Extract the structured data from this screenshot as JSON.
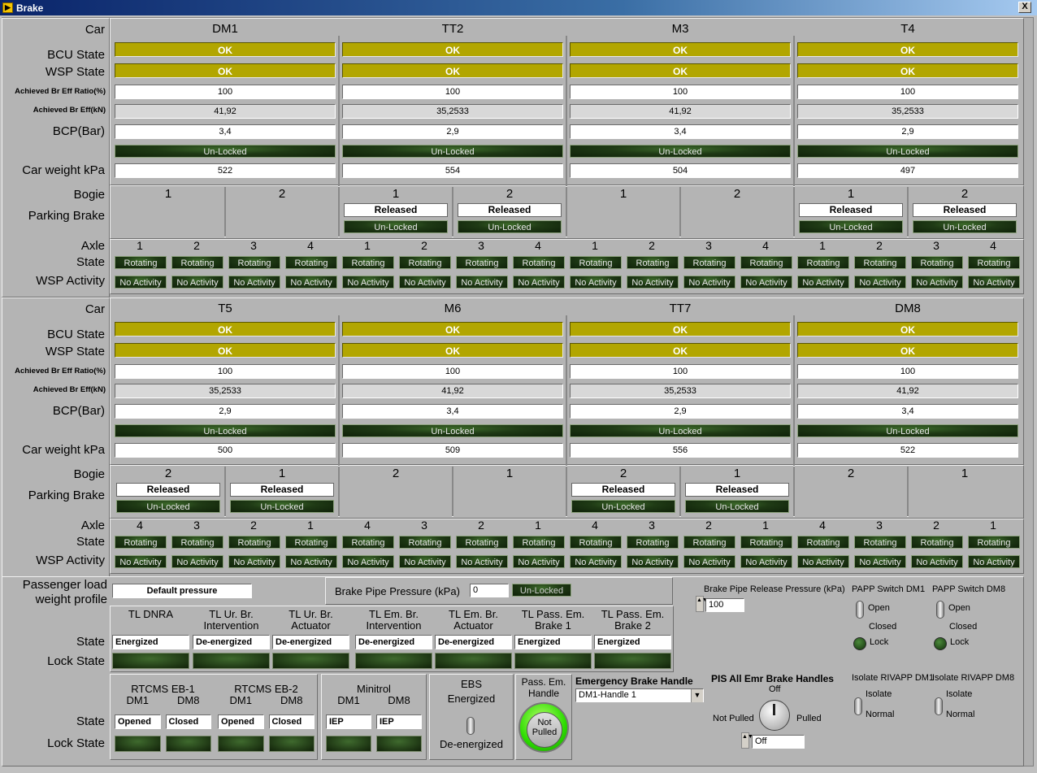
{
  "window": {
    "title": "Brake",
    "close": "X"
  },
  "labels": {
    "car": "Car",
    "bcu": "BCU State",
    "wsp": "WSP State",
    "ratio": "Achieved Br Eff Ratio(%)",
    "eff": "Achieved Br Eff(kN)",
    "bcp": "BCP(Bar)",
    "weight": "Car weight kPa",
    "bogie": "Bogie",
    "parking": "Parking Brake",
    "axle": "Axle",
    "state": "State",
    "wspact": "WSP Activity"
  },
  "upper": {
    "cars": [
      {
        "name": "DM1",
        "bcu": "OK",
        "wsp": "OK",
        "ratio": "100",
        "eff": "41,92",
        "bcp": "3,4",
        "lock": "Un-Locked",
        "weight": "522",
        "bogies": [
          {
            "n": "1",
            "released": "",
            "lock": ""
          },
          {
            "n": "2",
            "released": "",
            "lock": ""
          }
        ],
        "axles": [
          "1",
          "2",
          "3",
          "4"
        ]
      },
      {
        "name": "TT2",
        "bcu": "OK",
        "wsp": "OK",
        "ratio": "100",
        "eff": "35,2533",
        "bcp": "2,9",
        "lock": "Un-Locked",
        "weight": "554",
        "bogies": [
          {
            "n": "1",
            "released": "Released",
            "lock": "Un-Locked"
          },
          {
            "n": "2",
            "released": "Released",
            "lock": "Un-Locked"
          }
        ],
        "axles": [
          "1",
          "2",
          "3",
          "4"
        ]
      },
      {
        "name": "M3",
        "bcu": "OK",
        "wsp": "OK",
        "ratio": "100",
        "eff": "41,92",
        "bcp": "3,4",
        "lock": "Un-Locked",
        "weight": "504",
        "bogies": [
          {
            "n": "1",
            "released": "",
            "lock": ""
          },
          {
            "n": "2",
            "released": "",
            "lock": ""
          }
        ],
        "axles": [
          "1",
          "2",
          "3",
          "4"
        ]
      },
      {
        "name": "T4",
        "bcu": "OK",
        "wsp": "OK",
        "ratio": "100",
        "eff": "35,2533",
        "bcp": "2,9",
        "lock": "Un-Locked",
        "weight": "497",
        "bogies": [
          {
            "n": "1",
            "released": "Released",
            "lock": "Un-Locked"
          },
          {
            "n": "2",
            "released": "Released",
            "lock": "Un-Locked"
          }
        ],
        "axles": [
          "1",
          "2",
          "3",
          "4"
        ]
      }
    ]
  },
  "lower": {
    "cars": [
      {
        "name": "T5",
        "bcu": "OK",
        "wsp": "OK",
        "ratio": "100",
        "eff": "35,2533",
        "bcp": "2,9",
        "lock": "Un-Locked",
        "weight": "500",
        "bogies": [
          {
            "n": "2",
            "released": "Released",
            "lock": "Un-Locked"
          },
          {
            "n": "1",
            "released": "Released",
            "lock": "Un-Locked"
          }
        ],
        "axles": [
          "4",
          "3",
          "2",
          "1"
        ]
      },
      {
        "name": "M6",
        "bcu": "OK",
        "wsp": "OK",
        "ratio": "100",
        "eff": "41,92",
        "bcp": "3,4",
        "lock": "Un-Locked",
        "weight": "509",
        "bogies": [
          {
            "n": "2",
            "released": "",
            "lock": ""
          },
          {
            "n": "1",
            "released": "",
            "lock": ""
          }
        ],
        "axles": [
          "4",
          "3",
          "2",
          "1"
        ]
      },
      {
        "name": "TT7",
        "bcu": "OK",
        "wsp": "OK",
        "ratio": "100",
        "eff": "35,2533",
        "bcp": "2,9",
        "lock": "Un-Locked",
        "weight": "556",
        "bogies": [
          {
            "n": "2",
            "released": "Released",
            "lock": "Un-Locked"
          },
          {
            "n": "1",
            "released": "Released",
            "lock": "Un-Locked"
          }
        ],
        "axles": [
          "4",
          "3",
          "2",
          "1"
        ]
      },
      {
        "name": "DM8",
        "bcu": "OK",
        "wsp": "OK",
        "ratio": "100",
        "eff": "41,92",
        "bcp": "3,4",
        "lock": "Un-Locked",
        "weight": "522",
        "bogies": [
          {
            "n": "2",
            "released": "",
            "lock": ""
          },
          {
            "n": "1",
            "released": "",
            "lock": ""
          }
        ],
        "axles": [
          "4",
          "3",
          "2",
          "1"
        ]
      }
    ]
  },
  "axle_state": "Rotating",
  "wsp_activity": "No Activity",
  "bottom": {
    "pass_load_label": "Passenger load weight profile",
    "pass_load_value": "Default pressure",
    "bpp_label": "Brake Pipe Pressure (kPa)",
    "bpp_value": "0",
    "bpp_lock": "Un-Locked",
    "state_label": "State",
    "lock_state_label": "Lock State",
    "tl": [
      {
        "name": "TL DNRA",
        "state": "Energized"
      },
      {
        "name": "TL Ur. Br. Intervention",
        "state": "De-energized"
      },
      {
        "name": "TL Ur. Br. Actuator",
        "state": "De-energized"
      },
      {
        "name": "TL Em. Br. Intervention",
        "state": "De-energized"
      },
      {
        "name": "TL Em. Br. Actuator",
        "state": "De-energized"
      },
      {
        "name": "TL Pass. Em. Brake 1",
        "state": "Energized"
      },
      {
        "name": "TL Pass. Em. Brake 2",
        "state": "Energized"
      }
    ],
    "rtcms1": {
      "title": "RTCMS EB-1",
      "c1": "DM1",
      "c2": "DM8",
      "v1": "Opened",
      "v2": "Closed"
    },
    "rtcms2": {
      "title": "RTCMS EB-2",
      "c1": "DM1",
      "c2": "DM8",
      "v1": "Opened",
      "v2": "Closed"
    },
    "minitrol": {
      "title": "Minitrol",
      "c1": "DM1",
      "c2": "DM8",
      "v1": "IEP",
      "v2": "IEP"
    },
    "ebs": {
      "title": "EBS",
      "top": "Energized",
      "bottom": "De-energized"
    },
    "pass_em": {
      "title": "Pass. Em. Handle",
      "text": "Not Pulled"
    },
    "ebh": {
      "title": "Emergency Brake Handle",
      "value": "DM1-Handle 1"
    },
    "bprp": {
      "label": "Brake Pipe Release Pressure (kPa)",
      "value": "100"
    },
    "papp1": {
      "title": "PAPP Switch DM1",
      "open": "Open",
      "closed": "Closed",
      "lock": "Lock"
    },
    "papp2": {
      "title": "PAPP Switch DM8",
      "open": "Open",
      "closed": "Closed",
      "lock": "Lock"
    },
    "pis": {
      "title": "PIS All Emr Brake Handles",
      "off": "Off",
      "not_pulled": "Not Pulled",
      "pulled": "Pulled",
      "value": "Off"
    },
    "riv1": {
      "title": "Isolate RIVAPP DM1",
      "isolate": "Isolate",
      "normal": "Normal"
    },
    "riv2": {
      "title": "Isolate RIVAPP DM8",
      "isolate": "Isolate",
      "normal": "Normal"
    }
  }
}
